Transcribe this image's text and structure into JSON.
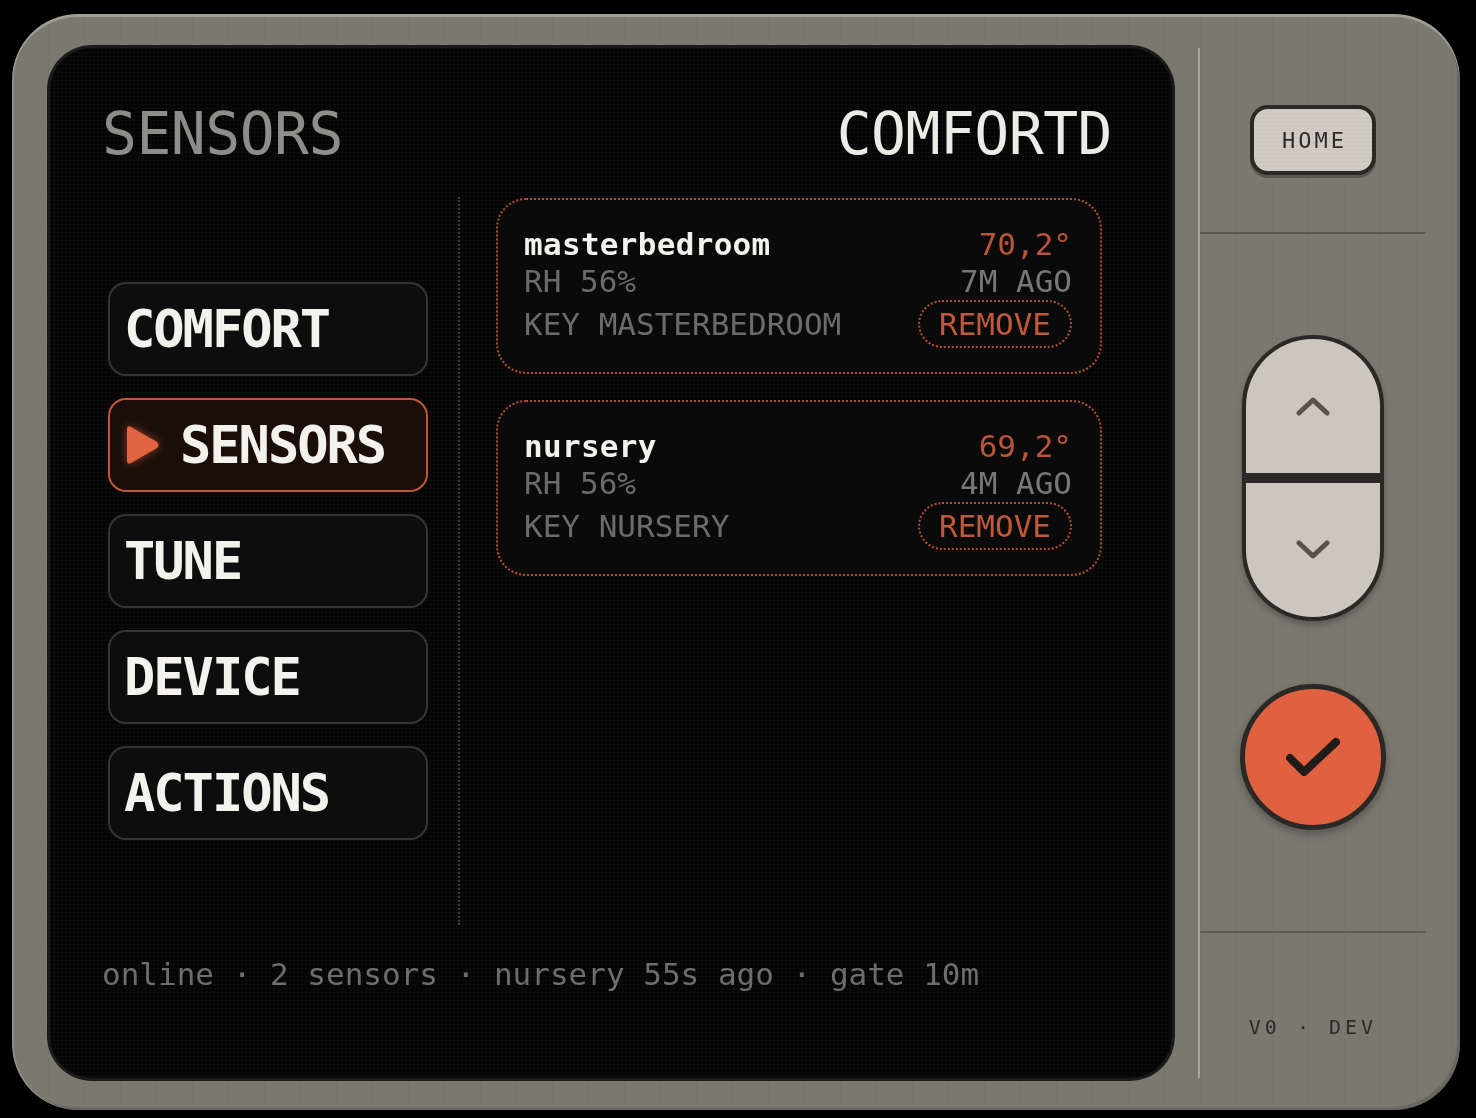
{
  "screen": {
    "title": "SENSORS",
    "brand": "COMFORTD",
    "nav": [
      {
        "label": "COMFORT",
        "selected": false
      },
      {
        "label": "SENSORS",
        "selected": true
      },
      {
        "label": "TUNE",
        "selected": false
      },
      {
        "label": "DEVICE",
        "selected": false
      },
      {
        "label": "ACTIONS",
        "selected": false
      }
    ],
    "sensors": [
      {
        "name": "masterbedroom",
        "temperature": "70,2°",
        "humidity": "RH 56%",
        "updated": "7M AGO",
        "key": "KEY MASTERBEDROOM",
        "action": "REMOVE"
      },
      {
        "name": "nursery",
        "temperature": "69,2°",
        "humidity": "RH 56%",
        "updated": "4M AGO",
        "key": "KEY NURSERY",
        "action": "REMOVE"
      }
    ],
    "status_bar": "online · 2 sensors · nursery 55s ago · gate 10m"
  },
  "controls": {
    "home": "HOME",
    "version": "V0 · DEV"
  }
}
